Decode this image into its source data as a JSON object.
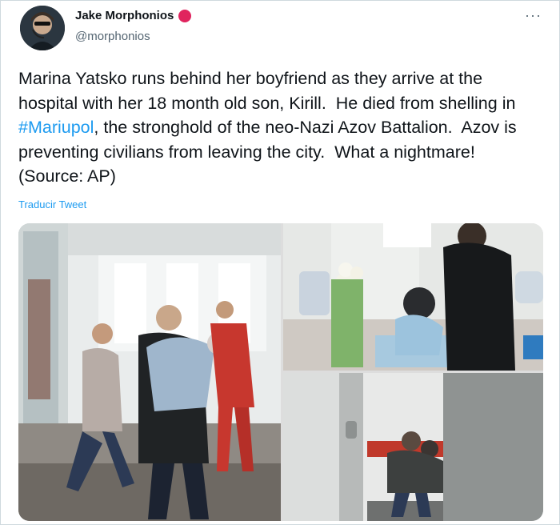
{
  "author": {
    "name": "Jake Morphonios",
    "handle": "@morphonios",
    "badge_color": "#e0245e"
  },
  "menu": {
    "more_label": "···"
  },
  "tweet": {
    "text_before": "Marina Yatsko runs behind her boyfriend as they arrive at the hospital with her 18 month old son, Kirill.  He died from shelling in ",
    "hashtag": "#Mariupol",
    "text_after": ", the stronghold of the neo-Nazi Azov Battalion.  Azov is preventing civilians from leaving the city.  What a nightmare!  (Source: AP)",
    "translate_label": "Traducir Tweet"
  },
  "colors": {
    "link": "#1d9bf0",
    "text": "#0f1419",
    "muted": "#536471"
  }
}
